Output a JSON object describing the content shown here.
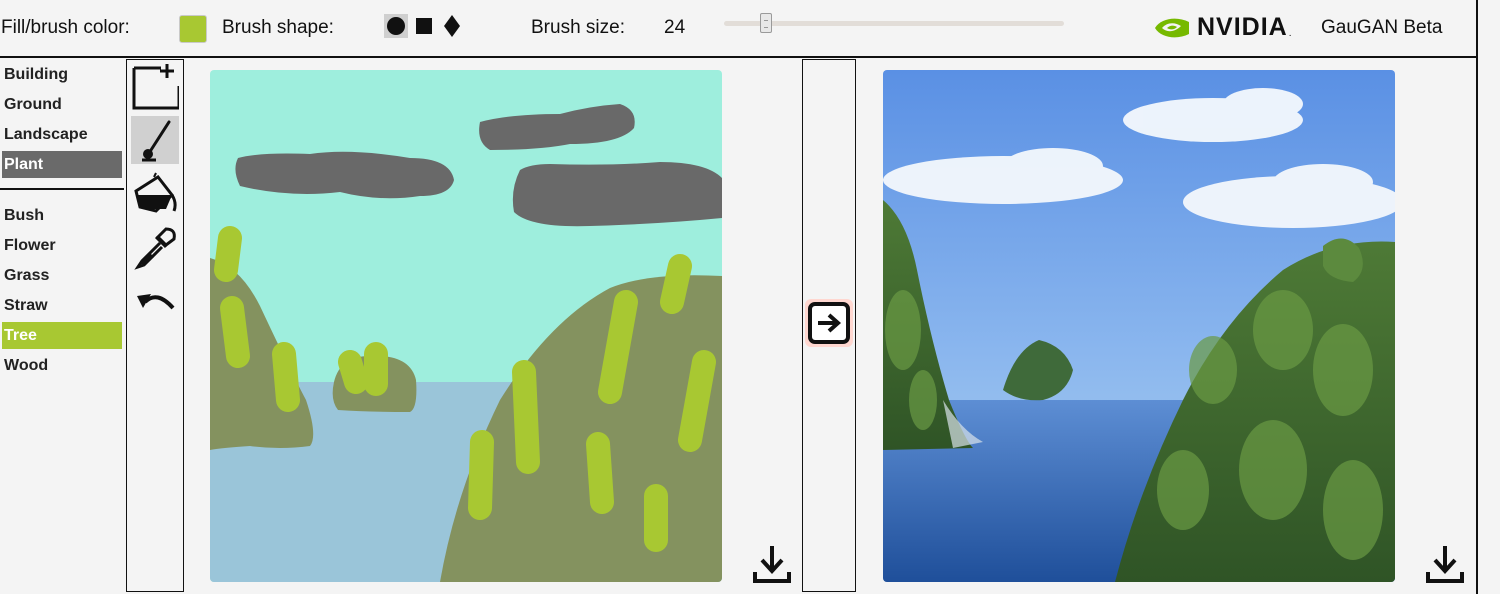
{
  "toolbar": {
    "fill_label": "Fill/brush color:",
    "fill_color": "#a8c832",
    "shape_label": "Brush shape:",
    "shapes": [
      "circle-icon",
      "square-icon",
      "diamond-icon"
    ],
    "size_label": "Brush size:",
    "size_value": "24",
    "brand": "NVIDIA",
    "app_title": "GauGAN Beta"
  },
  "labels": {
    "items": [
      {
        "label": "Building"
      },
      {
        "label": "Ground"
      },
      {
        "label": "Landscape"
      },
      {
        "label": "Plant"
      },
      {
        "label": "Bush"
      },
      {
        "label": "Flower"
      },
      {
        "label": "Grass"
      },
      {
        "label": "Straw"
      },
      {
        "label": "Tree"
      },
      {
        "label": "Wood"
      }
    ],
    "active_category": "Plant",
    "selected": "Tree"
  },
  "tools": [
    "new-canvas-icon",
    "brush-icon",
    "paint-bucket-icon",
    "eyedropper-icon",
    "undo-icon"
  ],
  "colors": {
    "sky": "#9eeedd",
    "cloud": "#696969",
    "water": "#9ac5d9",
    "hill": "#84925f",
    "tree": "#a8c832",
    "accent": "#76b900"
  }
}
